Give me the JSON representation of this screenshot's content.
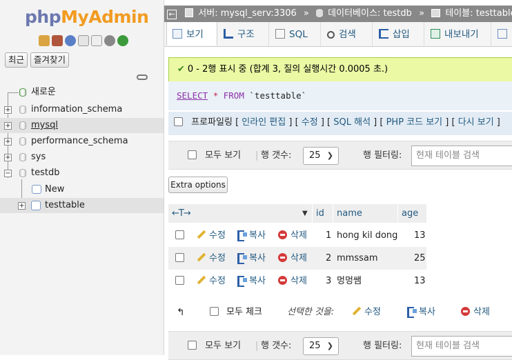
{
  "sidebar": {
    "logo_php": "php",
    "logo_myadmin": "MyAdmin",
    "tab_recent": "최근",
    "tab_favorites": "즐겨찾기",
    "tree": {
      "new_label": "새로운",
      "databases": [
        "information_schema",
        "mysql",
        "performance_schema",
        "sys",
        "testdb"
      ],
      "testdb_new": "New",
      "testdb_table": "testtable"
    }
  },
  "breadcrumb": {
    "server_label": "서버: mysql_serv:3306",
    "database_label": "데이터베이스: testdb",
    "table_label": "테이블: testtable",
    "separator": "»"
  },
  "tabs": [
    {
      "label": "보기"
    },
    {
      "label": "구조"
    },
    {
      "label": "SQL"
    },
    {
      "label": "검색"
    },
    {
      "label": "삽입"
    },
    {
      "label": "내보내기"
    }
  ],
  "message": "0 - 2행 표시 중 (합계 3, 질의 실행시간 0.0005 초.)",
  "sql": {
    "select": "SELECT",
    "star": "*",
    "from": "FROM",
    "table": "`testtable`"
  },
  "profiling": {
    "label": "프로파일링",
    "links": [
      "인라인 편집",
      "수정",
      "SQL 해석",
      "PHP 코드 보기",
      "다시 보기"
    ]
  },
  "navbar": {
    "show_all": "모두 보기",
    "row_count_label": "행 갯수:",
    "row_count_value": "25",
    "row_filter_label": "행 필터링:",
    "filter_placeholder": "현재 테이블 검색"
  },
  "extra_options": "Extra options",
  "table": {
    "arrows": "←T→",
    "columns": [
      "id",
      "name",
      "age"
    ],
    "actions": {
      "edit": "수정",
      "copy": "복사",
      "delete": "삭제"
    },
    "rows": [
      {
        "id": "1",
        "name": "hong kil dong",
        "age": "13"
      },
      {
        "id": "2",
        "name": "mmssam",
        "age": "25"
      },
      {
        "id": "3",
        "name": "멍멍쌤",
        "age": "13"
      }
    ]
  },
  "footer": {
    "check_all": "모두 체크",
    "with_selected": "선택한 것을:",
    "edit": "수정",
    "copy": "복사",
    "delete": "삭제"
  }
}
